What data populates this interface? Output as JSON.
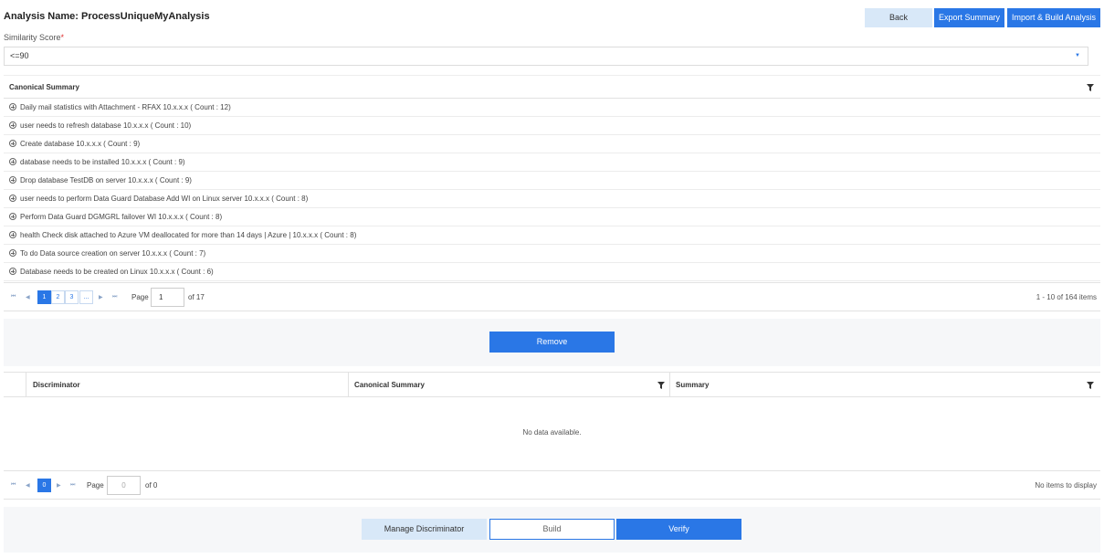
{
  "header": {
    "title": "Analysis Name: ProcessUniqueMyAnalysis",
    "back_label": "Back",
    "export_label": "Export Summary",
    "import_label": "Import & Build Analysis"
  },
  "similarity": {
    "label": "Similarity Score",
    "required_mark": "*",
    "selected_value": "<=90"
  },
  "summary_grid": {
    "column_header": "Canonical Summary",
    "rows": [
      "Daily mail statistics with Attachment - RFAX 10.x.x.x ( Count : 12)",
      "user needs to refresh database 10.x.x.x ( Count : 10)",
      "Create database 10.x.x.x ( Count : 9)",
      "database needs to be installed 10.x.x.x ( Count : 9)",
      "Drop database TestDB on server 10.x.x.x ( Count : 9)",
      "user needs to perform Data Guard Database Add WI on Linux server 10.x.x.x ( Count : 8)",
      "Perform Data Guard DGMGRL failover WI 10.x.x.x ( Count : 8)",
      "health Check disk attached to Azure VM deallocated for more than 14 days | Azure | 10.x.x.x ( Count : 8)",
      "To do Data source creation on server 10.x.x.x ( Count : 7)",
      "Database needs to be created on Linux 10.x.x.x ( Count : 6)"
    ],
    "pager": {
      "pages": [
        "1",
        "2",
        "3",
        "..."
      ],
      "page_label": "Page",
      "current_page": "1",
      "of_label": "of 17",
      "info": "1 - 10 of 164 items"
    }
  },
  "remove_label": "Remove",
  "discriminator_grid": {
    "columns": [
      "Discriminator",
      "Canonical Summary",
      "Summary"
    ],
    "empty_message": "No data available.",
    "pager": {
      "current_page_button": "0",
      "page_label": "Page",
      "page_input_value": "0",
      "of_label": "of 0",
      "info": "No items to display"
    }
  },
  "footer": {
    "manage_label": "Manage Discriminator",
    "build_label": "Build",
    "verify_label": "Verify"
  },
  "colors": {
    "primary": "#2a77e6",
    "light_button": "#d8e8f8",
    "band_background": "#f6f7f9"
  },
  "icons": [
    "filter-icon",
    "expand-plus-icon",
    "first-page-icon",
    "prev-page-icon",
    "next-page-icon",
    "last-page-icon",
    "dropdown-caret-icon"
  ]
}
